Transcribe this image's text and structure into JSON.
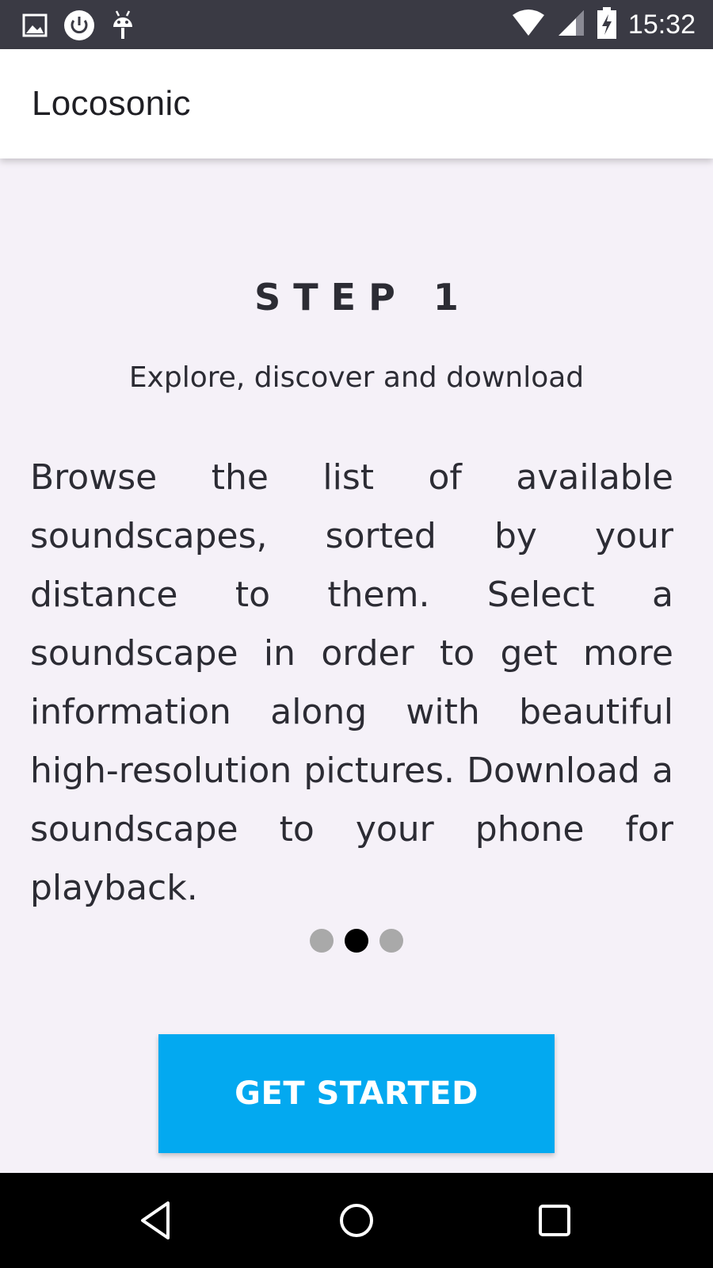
{
  "status_bar": {
    "time": "15:32",
    "icons_left": [
      "image-icon",
      "power-icon",
      "android-icon"
    ],
    "icons_right": [
      "wifi-icon",
      "cell-signal-icon",
      "battery-charging-icon"
    ]
  },
  "app_bar": {
    "title": "Locosonic"
  },
  "onboarding": {
    "step_title": "STEP 1",
    "subtitle": "Explore, discover and download",
    "body": "Browse the list of available soundscapes, sorted by your distance to them. Select a soundscape in order to get more information along with beautiful high-resolution pictures. Download a soundscape to your phone for playback.",
    "page_indicator": {
      "total": 3,
      "active_index": 1
    },
    "cta_label": "GET STARTED"
  },
  "nav_bar": {
    "buttons": [
      "back-icon",
      "home-icon",
      "recents-icon"
    ]
  },
  "colors": {
    "status_bar_bg": "#3a3a44",
    "background": "#f5f1f8",
    "accent": "#03a9f0",
    "text": "#2c2c34"
  }
}
